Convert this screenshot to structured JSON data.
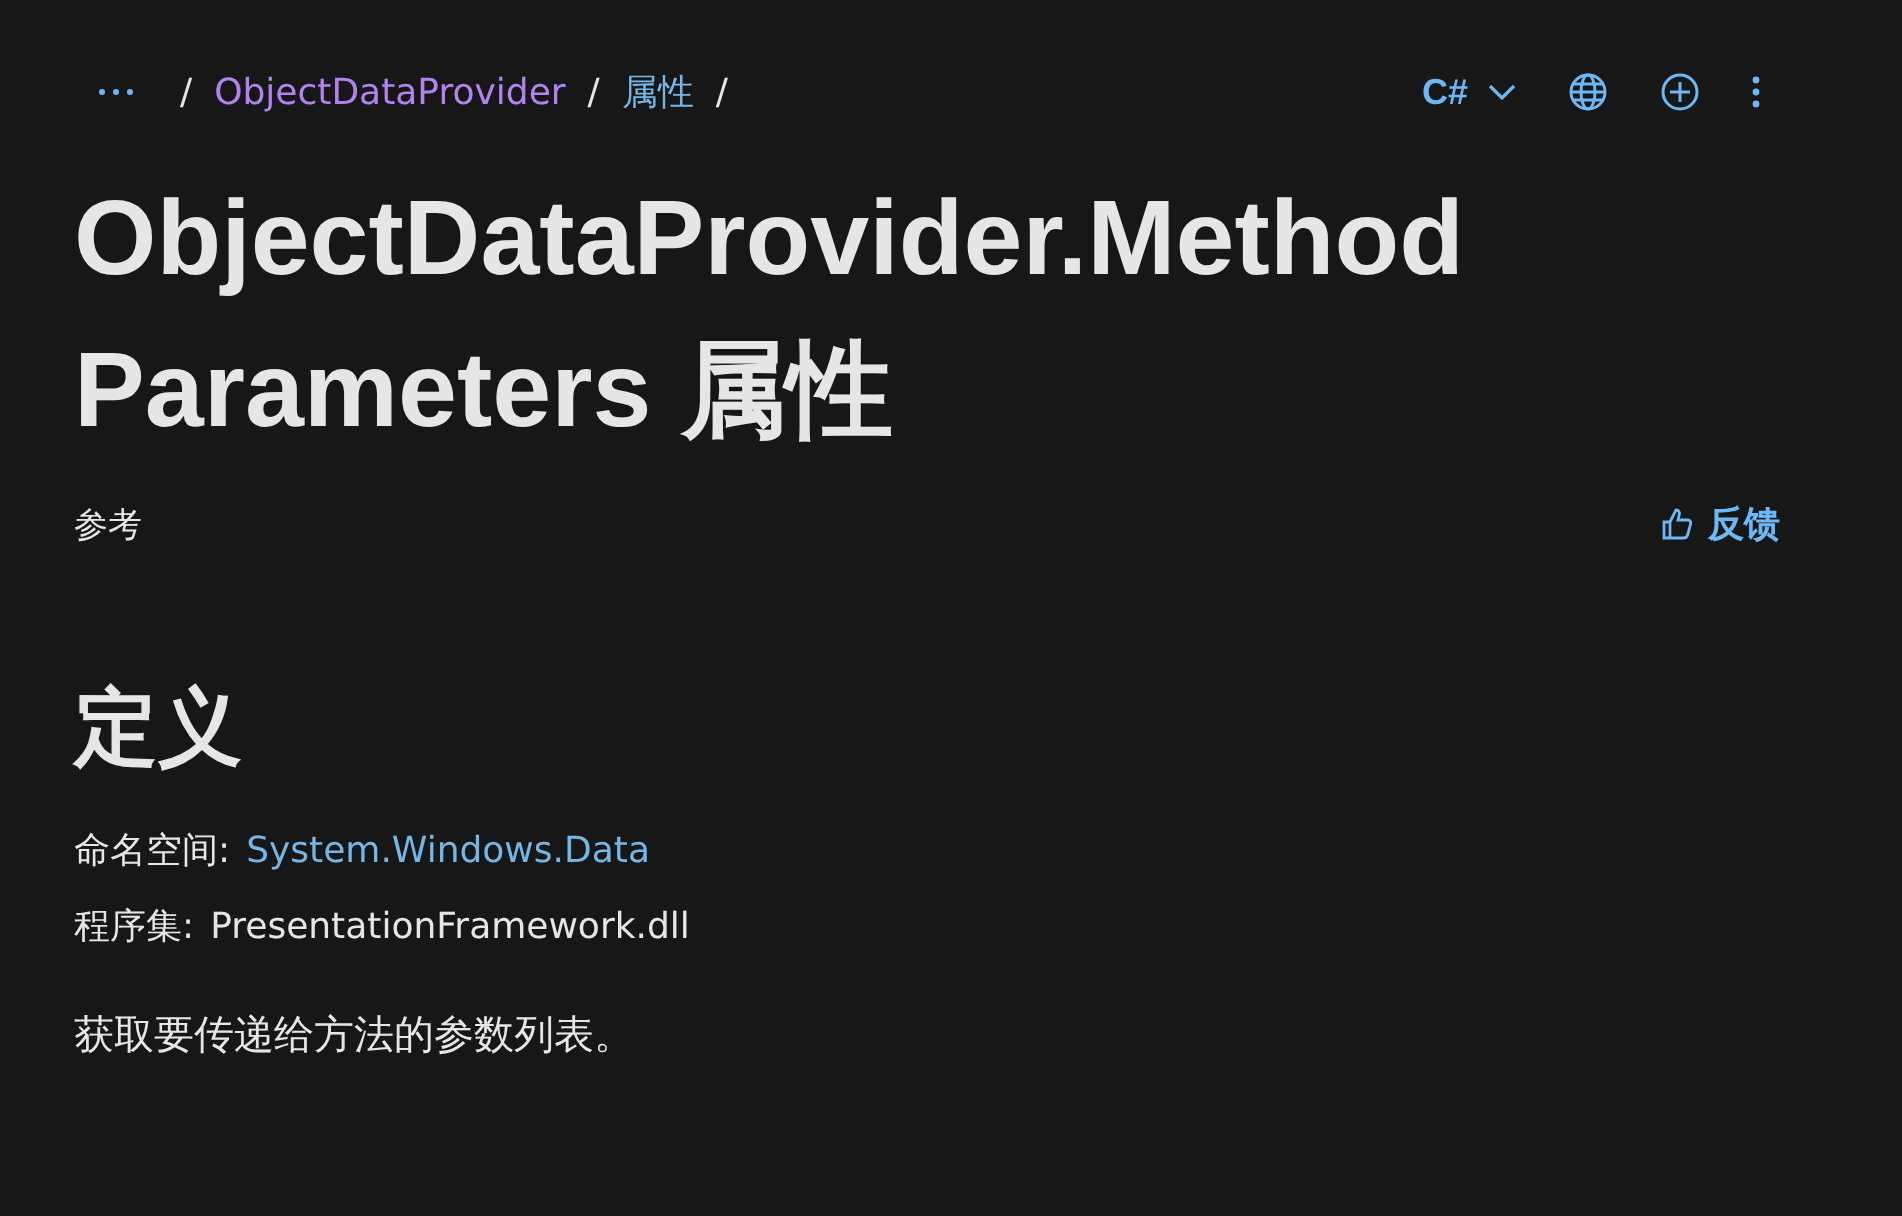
{
  "breadcrumb": [
    {
      "kind": "separator",
      "label": "/"
    },
    {
      "kind": "link",
      "label": "ObjectDataProvider",
      "visited": true
    },
    {
      "kind": "separator",
      "label": "/"
    },
    {
      "kind": "link",
      "label": "属性",
      "visited": false
    },
    {
      "kind": "separator",
      "label": "/"
    }
  ],
  "toolbar": {
    "language": "C#"
  },
  "title": "ObjectDataProvider.MethodParameters 属性",
  "page_type": "参考",
  "feedback": "反馈",
  "definition": {
    "heading": "定义",
    "rows": [
      {
        "label": "命名空间:",
        "value": "System.Windows.Data",
        "kind": "link"
      },
      {
        "label": "程序集:",
        "value": "PresentationFramework.dll",
        "kind": "text"
      }
    ]
  },
  "summary": "获取要传递给方法的参数列表。"
}
